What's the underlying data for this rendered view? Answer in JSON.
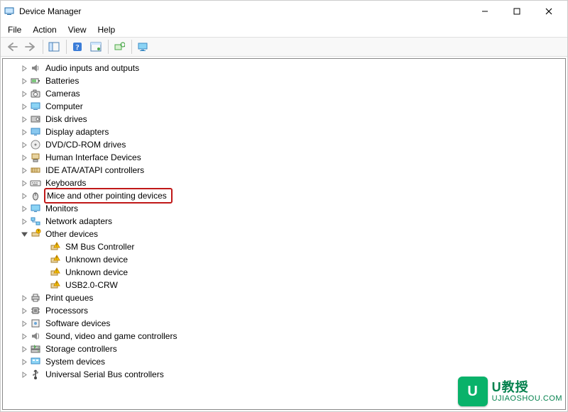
{
  "window": {
    "title": "Device Manager"
  },
  "menu": {
    "file": "File",
    "action": "Action",
    "view": "View",
    "help": "Help"
  },
  "tree": [
    {
      "level": 1,
      "expand": "right",
      "icon": "audio",
      "label": "Audio inputs and outputs",
      "hl": false
    },
    {
      "level": 1,
      "expand": "right",
      "icon": "battery",
      "label": "Batteries",
      "hl": false
    },
    {
      "level": 1,
      "expand": "right",
      "icon": "camera",
      "label": "Cameras",
      "hl": false
    },
    {
      "level": 1,
      "expand": "right",
      "icon": "computer",
      "label": "Computer",
      "hl": false
    },
    {
      "level": 1,
      "expand": "right",
      "icon": "disk",
      "label": "Disk drives",
      "hl": false
    },
    {
      "level": 1,
      "expand": "right",
      "icon": "display",
      "label": "Display adapters",
      "hl": false
    },
    {
      "level": 1,
      "expand": "right",
      "icon": "dvd",
      "label": "DVD/CD-ROM drives",
      "hl": false
    },
    {
      "level": 1,
      "expand": "right",
      "icon": "hid",
      "label": "Human Interface Devices",
      "hl": false
    },
    {
      "level": 1,
      "expand": "right",
      "icon": "ide",
      "label": "IDE ATA/ATAPI controllers",
      "hl": false
    },
    {
      "level": 1,
      "expand": "right",
      "icon": "keyboard",
      "label": "Keyboards",
      "hl": false
    },
    {
      "level": 1,
      "expand": "right",
      "icon": "mouse",
      "label": "Mice and other pointing devices",
      "hl": true
    },
    {
      "level": 1,
      "expand": "right",
      "icon": "monitor",
      "label": "Monitors",
      "hl": false
    },
    {
      "level": 1,
      "expand": "right",
      "icon": "network",
      "label": "Network adapters",
      "hl": false
    },
    {
      "level": 1,
      "expand": "down",
      "icon": "other",
      "label": "Other devices",
      "hl": false
    },
    {
      "level": 2,
      "expand": "none",
      "icon": "warn",
      "label": "SM Bus Controller",
      "hl": false
    },
    {
      "level": 2,
      "expand": "none",
      "icon": "warn",
      "label": "Unknown device",
      "hl": false
    },
    {
      "level": 2,
      "expand": "none",
      "icon": "warn",
      "label": "Unknown device",
      "hl": false
    },
    {
      "level": 2,
      "expand": "none",
      "icon": "warn",
      "label": "USB2.0-CRW",
      "hl": false
    },
    {
      "level": 1,
      "expand": "right",
      "icon": "print",
      "label": "Print queues",
      "hl": false
    },
    {
      "level": 1,
      "expand": "right",
      "icon": "cpu",
      "label": "Processors",
      "hl": false
    },
    {
      "level": 1,
      "expand": "right",
      "icon": "software",
      "label": "Software devices",
      "hl": false
    },
    {
      "level": 1,
      "expand": "right",
      "icon": "sound",
      "label": "Sound, video and game controllers",
      "hl": false
    },
    {
      "level": 1,
      "expand": "right",
      "icon": "storage",
      "label": "Storage controllers",
      "hl": false
    },
    {
      "level": 1,
      "expand": "right",
      "icon": "system",
      "label": "System devices",
      "hl": false
    },
    {
      "level": 1,
      "expand": "right",
      "icon": "usb",
      "label": "Universal Serial Bus controllers",
      "hl": false
    }
  ],
  "watermark": {
    "logo": "U",
    "line1": "U教授",
    "line2": "UJIAOSHOU.COM"
  }
}
